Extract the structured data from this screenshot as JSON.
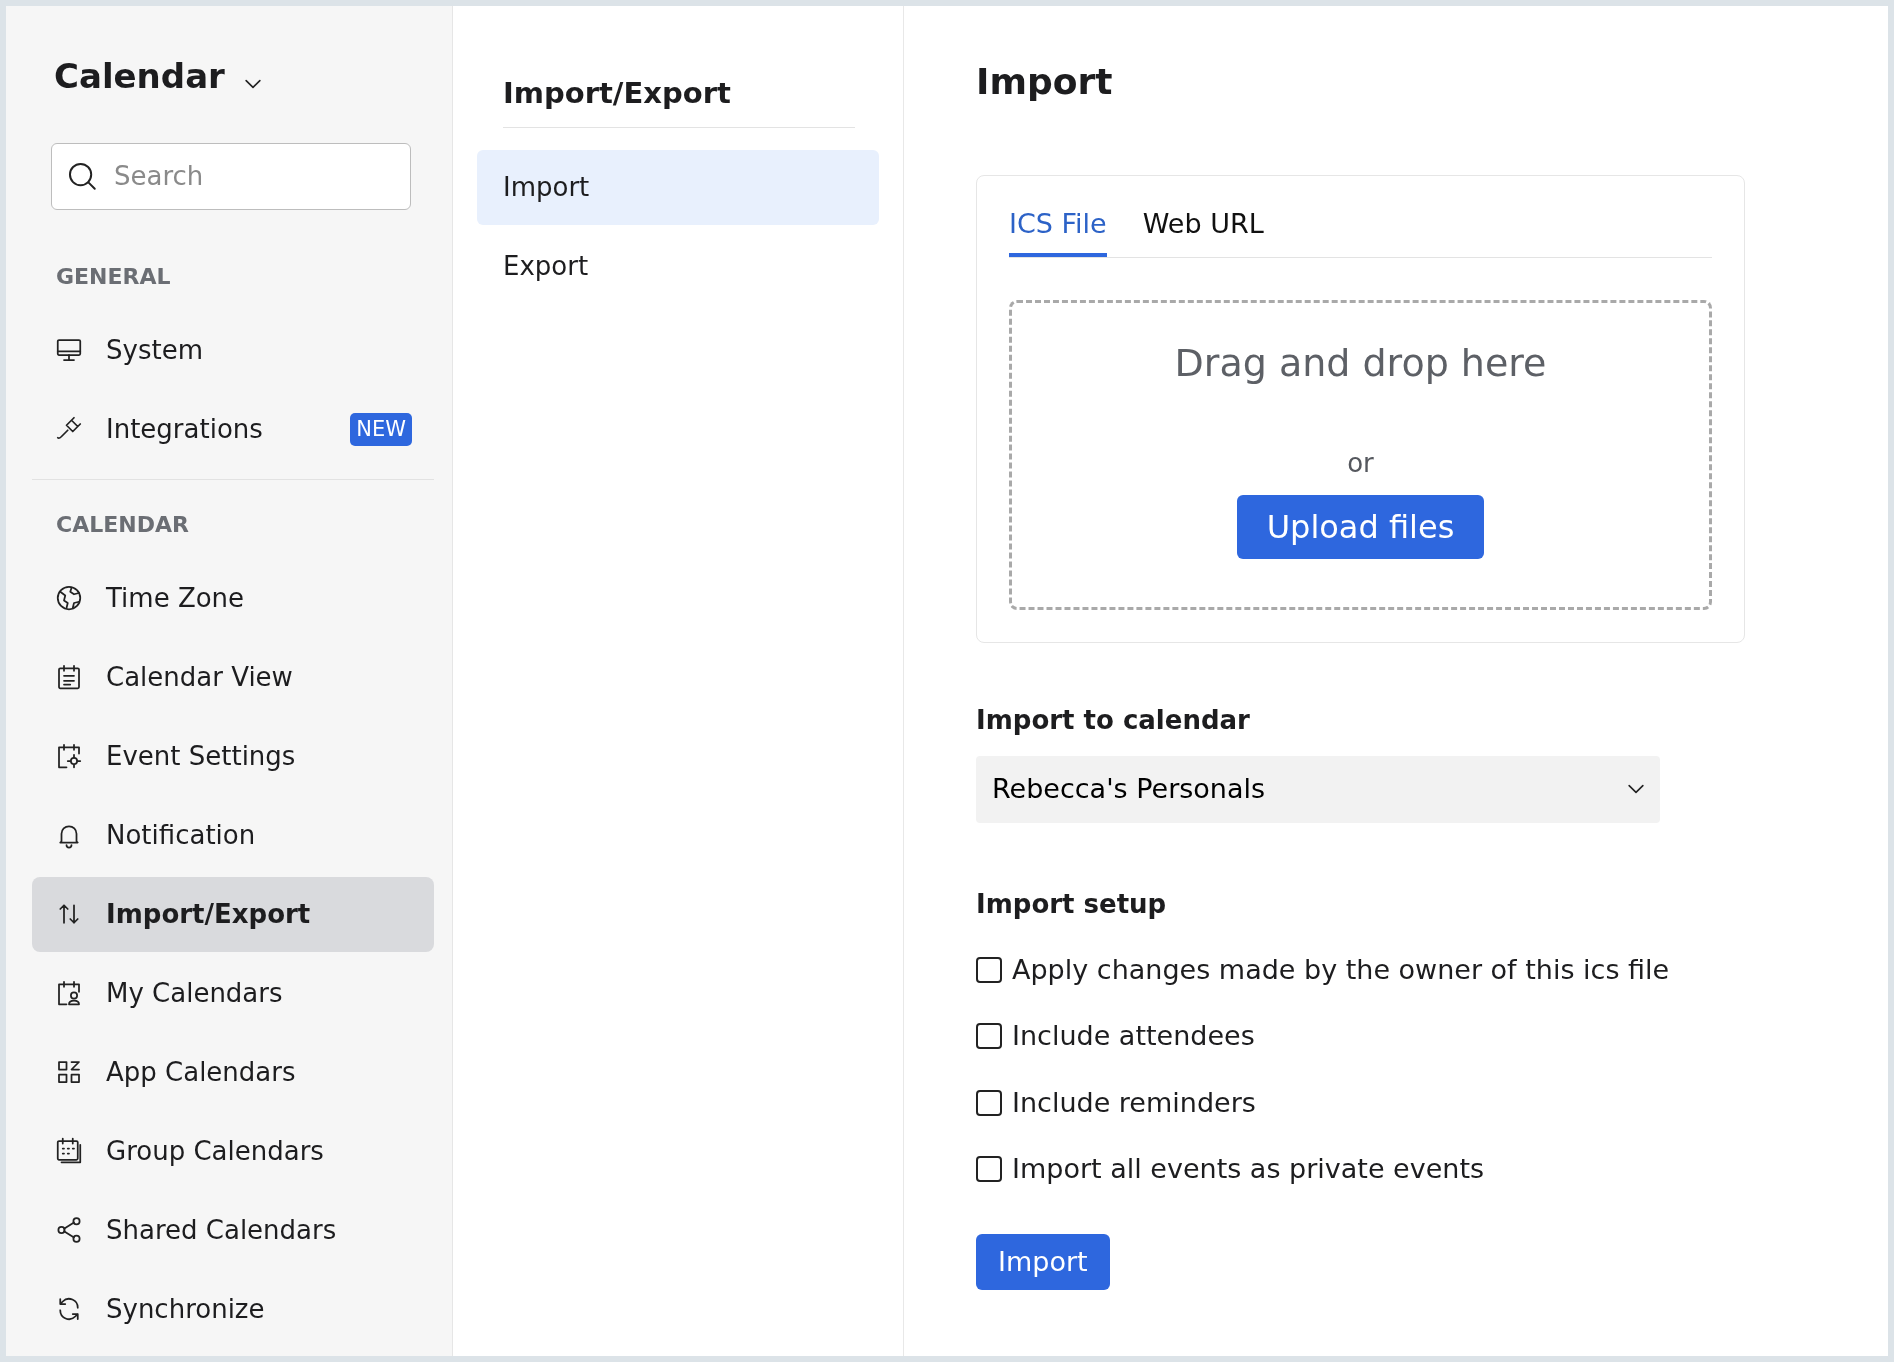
{
  "sidebar": {
    "title": "Calendar",
    "search": {
      "placeholder": "Search"
    },
    "sections": [
      {
        "heading": "GENERAL",
        "items": [
          {
            "label": "System",
            "selected": false
          },
          {
            "label": "Integrations",
            "selected": false,
            "badge": "NEW"
          }
        ]
      },
      {
        "heading": "CALENDAR",
        "items": [
          {
            "label": "Time Zone",
            "selected": false
          },
          {
            "label": "Calendar View",
            "selected": false
          },
          {
            "label": "Event Settings",
            "selected": false
          },
          {
            "label": "Notification",
            "selected": false
          },
          {
            "label": "Import/Export",
            "selected": true
          },
          {
            "label": "My Calendars",
            "selected": false
          },
          {
            "label": "App Calendars",
            "selected": false
          },
          {
            "label": "Group Calendars",
            "selected": false
          },
          {
            "label": "Shared Calendars",
            "selected": false
          },
          {
            "label": "Synchronize",
            "selected": false
          }
        ]
      }
    ]
  },
  "subnav": {
    "title": "Import/Export",
    "items": [
      {
        "label": "Import",
        "selected": true
      },
      {
        "label": "Export",
        "selected": false
      }
    ]
  },
  "main": {
    "title": "Import",
    "tabs": [
      {
        "label": "ICS File",
        "selected": true
      },
      {
        "label": "Web URL",
        "selected": false
      }
    ],
    "dropzone": {
      "text": "Drag and drop here",
      "or": "or",
      "button": "Upload files"
    },
    "calendar_label": "Import to calendar",
    "calendar_value": "Rebecca's Personals",
    "setup_label": "Import setup",
    "options": [
      {
        "label": "Apply changes made by the owner of this ics file",
        "checked": false
      },
      {
        "label": "Include attendees",
        "checked": false
      },
      {
        "label": "Include reminders",
        "checked": false
      },
      {
        "label": "Import all events as private events",
        "checked": false
      }
    ],
    "submit": "Import"
  }
}
